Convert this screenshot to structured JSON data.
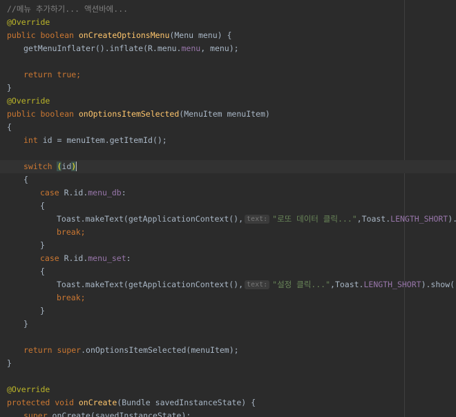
{
  "editor": {
    "lines": [
      {
        "indent": 0,
        "tokens": [
          {
            "t": "//메뉴 추가하기... 액션바에...",
            "c": "comment"
          }
        ]
      },
      {
        "indent": 0,
        "tokens": [
          {
            "t": "@Override",
            "c": "anno"
          }
        ]
      },
      {
        "indent": 0,
        "tokens": [
          {
            "t": "public ",
            "c": "kw"
          },
          {
            "t": "boolean ",
            "c": "kw"
          },
          {
            "t": "onCreateOptionsMenu",
            "c": "fn"
          },
          {
            "t": "(Menu menu) {",
            "c": "plain"
          }
        ]
      },
      {
        "indent": 1,
        "tokens": [
          {
            "t": "getMenuInflater().inflate(R.menu.",
            "c": "plain"
          },
          {
            "t": "menu",
            "c": "field"
          },
          {
            "t": ", menu);",
            "c": "plain"
          }
        ]
      },
      {
        "indent": 0,
        "tokens": []
      },
      {
        "indent": 1,
        "tokens": [
          {
            "t": "return ",
            "c": "kw"
          },
          {
            "t": "true",
            "c": "kw"
          },
          {
            "t": ";",
            "c": "kw"
          }
        ]
      },
      {
        "indent": 0,
        "tokens": [
          {
            "t": "}",
            "c": "plain"
          }
        ]
      },
      {
        "indent": 0,
        "tokens": [
          {
            "t": "@Override",
            "c": "anno"
          }
        ]
      },
      {
        "indent": 0,
        "tokens": [
          {
            "t": "public ",
            "c": "kw"
          },
          {
            "t": "boolean ",
            "c": "kw"
          },
          {
            "t": "onOptionsItemSelected",
            "c": "fn"
          },
          {
            "t": "(MenuItem menuItem)",
            "c": "plain"
          }
        ]
      },
      {
        "indent": 0,
        "tokens": [
          {
            "t": "{",
            "c": "plain"
          }
        ]
      },
      {
        "indent": 1,
        "tokens": [
          {
            "t": "int ",
            "c": "kw"
          },
          {
            "t": "id = menuItem.getItemId();",
            "c": "plain"
          }
        ]
      },
      {
        "indent": 0,
        "tokens": []
      },
      {
        "indent": 1,
        "current": true,
        "tokens": [
          {
            "t": "switch ",
            "c": "kw"
          },
          {
            "t": "(",
            "c": "bracket"
          },
          {
            "t": "id",
            "c": "plain"
          },
          {
            "t": ")",
            "c": "bracket"
          },
          {
            "t": "",
            "c": "caret"
          }
        ]
      },
      {
        "indent": 1,
        "tokens": [
          {
            "t": "{",
            "c": "plain"
          }
        ]
      },
      {
        "indent": 2,
        "tokens": [
          {
            "t": "case ",
            "c": "kw"
          },
          {
            "t": "R.id.",
            "c": "plain"
          },
          {
            "t": "menu_db",
            "c": "field"
          },
          {
            "t": ":",
            "c": "plain"
          }
        ]
      },
      {
        "indent": 2,
        "tokens": [
          {
            "t": "{",
            "c": "plain"
          }
        ]
      },
      {
        "indent": 3,
        "tokens": [
          {
            "t": "Toast.makeText(getApplicationContext(),",
            "c": "plain"
          },
          {
            "t": "text:",
            "c": "hint"
          },
          {
            "t": "\"로또 데이터 클릭...\"",
            "c": "str"
          },
          {
            "t": ",Toast.",
            "c": "plain"
          },
          {
            "t": "LENGTH_SHORT",
            "c": "field"
          },
          {
            "t": ").show();",
            "c": "plain"
          }
        ]
      },
      {
        "indent": 3,
        "tokens": [
          {
            "t": "break;",
            "c": "kw"
          }
        ]
      },
      {
        "indent": 2,
        "tokens": [
          {
            "t": "}",
            "c": "plain"
          }
        ]
      },
      {
        "indent": 2,
        "tokens": [
          {
            "t": "case ",
            "c": "kw"
          },
          {
            "t": "R.id.",
            "c": "plain"
          },
          {
            "t": "menu_set",
            "c": "field"
          },
          {
            "t": ":",
            "c": "plain"
          }
        ]
      },
      {
        "indent": 2,
        "tokens": [
          {
            "t": "{",
            "c": "plain"
          }
        ]
      },
      {
        "indent": 3,
        "tokens": [
          {
            "t": "Toast.makeText(getApplicationContext(),",
            "c": "plain"
          },
          {
            "t": "text:",
            "c": "hint"
          },
          {
            "t": "\"설정 클릭...\"",
            "c": "str"
          },
          {
            "t": ",Toast.",
            "c": "plain"
          },
          {
            "t": "LENGTH_SHORT",
            "c": "field"
          },
          {
            "t": ").show();",
            "c": "plain"
          }
        ]
      },
      {
        "indent": 3,
        "tokens": [
          {
            "t": "break;",
            "c": "kw"
          }
        ]
      },
      {
        "indent": 2,
        "tokens": [
          {
            "t": "}",
            "c": "plain"
          }
        ]
      },
      {
        "indent": 1,
        "tokens": [
          {
            "t": "}",
            "c": "plain"
          }
        ]
      },
      {
        "indent": 0,
        "tokens": []
      },
      {
        "indent": 1,
        "tokens": [
          {
            "t": "return ",
            "c": "kw"
          },
          {
            "t": "super",
            "c": "kw"
          },
          {
            "t": ".onOptionsItemSelected(menuItem);",
            "c": "plain"
          }
        ]
      },
      {
        "indent": 0,
        "tokens": [
          {
            "t": "}",
            "c": "plain"
          }
        ]
      },
      {
        "indent": 0,
        "tokens": []
      },
      {
        "indent": 0,
        "tokens": [
          {
            "t": "@Override",
            "c": "anno"
          }
        ]
      },
      {
        "indent": 0,
        "tokens": [
          {
            "t": "protected ",
            "c": "kw"
          },
          {
            "t": "void ",
            "c": "kw"
          },
          {
            "t": "onCreate",
            "c": "fn"
          },
          {
            "t": "(Bundle savedInstanceState) {",
            "c": "plain"
          }
        ]
      },
      {
        "indent": 1,
        "tokens": [
          {
            "t": "super",
            "c": "kw"
          },
          {
            "t": ".onCreate(savedInstanceState);",
            "c": "plain"
          }
        ]
      }
    ]
  },
  "colors": {
    "background": "#2b2b2b",
    "current_line": "#323232",
    "comment": "#808080",
    "annotation": "#bbb529",
    "keyword": "#cc7832",
    "method": "#ffc66d",
    "field": "#9876aa",
    "string": "#6a8759",
    "plain": "#a9b7c6"
  }
}
